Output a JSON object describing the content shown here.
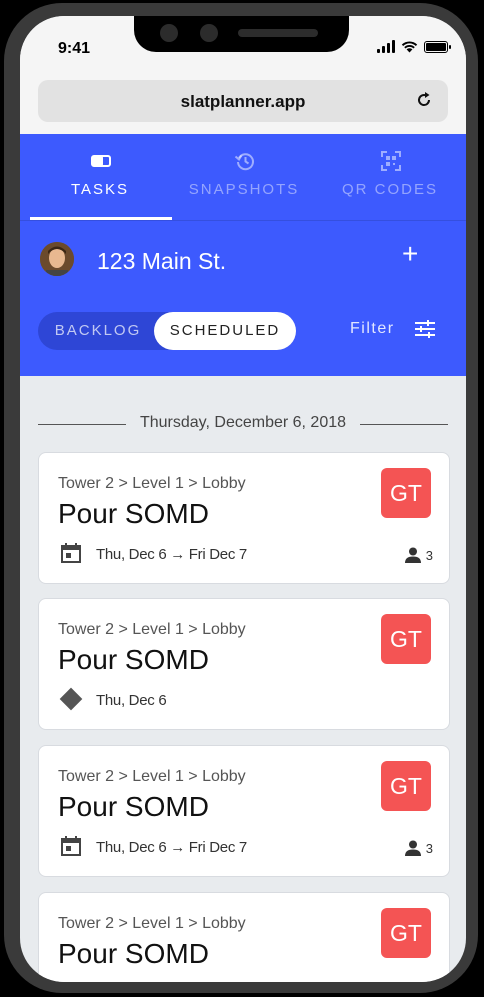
{
  "status_bar": {
    "time": "9:41"
  },
  "browser": {
    "url": "slatplanner.app"
  },
  "nav_tabs": [
    {
      "label": "TASKS",
      "icon": "toggle-rect-icon",
      "active": true
    },
    {
      "label": "SNAPSHOTS",
      "icon": "history-icon",
      "active": false
    },
    {
      "label": "QR CODES",
      "icon": "qr-code-icon",
      "active": false
    }
  ],
  "project": {
    "name": "123 Main St.",
    "add_label": "+"
  },
  "view_toggle": {
    "backlog": "BACKLOG",
    "scheduled": "SCHEDULED",
    "selected": "SCHEDULED"
  },
  "filter": {
    "label": "Filter"
  },
  "date_header": "Thursday, December 6, 2018",
  "colors": {
    "primary": "#3d5afe",
    "badge": "#f45454",
    "background": "#e8ebee"
  },
  "tasks": [
    {
      "path": "Tower 2 > Level 1 > Lobby",
      "title": "Pour SOMD",
      "badge": "GT",
      "type": "range",
      "dates": "Thu, Dec 6 → Fri Dec 7",
      "people": "3"
    },
    {
      "path": "Tower 2 > Level 1 > Lobby",
      "title": "Pour SOMD",
      "badge": "GT",
      "type": "milestone",
      "dates": "Thu, Dec 6",
      "people": ""
    },
    {
      "path": "Tower 2 > Level 1 > Lobby",
      "title": "Pour SOMD",
      "badge": "GT",
      "type": "range",
      "dates": "Thu, Dec 6 → Fri Dec 7",
      "people": "3"
    },
    {
      "path": "Tower 2 > Level 1 > Lobby",
      "title": "Pour SOMD",
      "badge": "GT",
      "type": "range",
      "dates": "",
      "people": ""
    }
  ]
}
